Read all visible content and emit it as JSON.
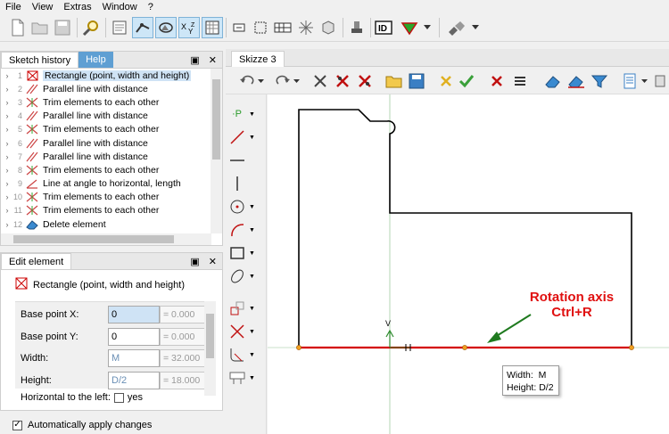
{
  "menu": [
    "File",
    "View",
    "Extras",
    "Window",
    "?"
  ],
  "colors": {
    "accent_blue": "#5f9fd3",
    "selection": "#cfe3f5",
    "sketch_line": "#000000",
    "axis_red": "#d40000",
    "axis_green": "#2e8b2e",
    "annotation_red": "#e01010",
    "annotation_arrow": "#1f7a1f",
    "canvas_bg": "#ffffff"
  },
  "toolbar": {
    "icons": [
      "new-icon",
      "open-icon",
      "save-icon",
      "search-icon",
      "sketch-icon",
      "select-icon",
      "rotate-icon",
      "xy-icon",
      "grid-icon",
      "dim-icon",
      "box-icon",
      "table-icon",
      "sparkle-icon",
      "cube-icon",
      "stamp-icon",
      "id-icon",
      "dropdown-icon",
      "plug-icon"
    ]
  },
  "sketch_history": {
    "tab_active": "Sketch history",
    "tab_inactive": "Help",
    "items": [
      {
        "num": "1",
        "label": "Rectangle (point, width and height)",
        "icon": "rectangle-icon",
        "selected": true
      },
      {
        "num": "2",
        "label": "Parallel line with distance",
        "icon": "parallel-icon"
      },
      {
        "num": "3",
        "label": "Trim elements to each other",
        "icon": "trim-icon"
      },
      {
        "num": "4",
        "label": "Parallel line with distance",
        "icon": "parallel-icon"
      },
      {
        "num": "5",
        "label": "Trim elements to each other",
        "icon": "trim-icon"
      },
      {
        "num": "6",
        "label": "Parallel line with distance",
        "icon": "parallel-icon"
      },
      {
        "num": "7",
        "label": "Parallel line with distance",
        "icon": "parallel-icon"
      },
      {
        "num": "8",
        "label": "Trim elements to each other",
        "icon": "trim-icon"
      },
      {
        "num": "9",
        "label": "Line at angle to horizontal, length",
        "icon": "angle-line-icon"
      },
      {
        "num": "10",
        "label": "Trim elements to each other",
        "icon": "trim-icon"
      },
      {
        "num": "11",
        "label": "Trim elements to each other",
        "icon": "trim-icon"
      },
      {
        "num": "12",
        "label": "Delete element",
        "icon": "eraser-icon"
      }
    ]
  },
  "edit_element": {
    "tab": "Edit element",
    "title": "Rectangle (point, width and height)",
    "fields": [
      {
        "label": "Base point X:",
        "value": "0",
        "computed": "= 0.000"
      },
      {
        "label": "Base point Y:",
        "value": "0",
        "computed": "= 0.000"
      },
      {
        "label": "Width:",
        "value": "M",
        "computed": "= 32.000"
      },
      {
        "label": "Height:",
        "value": "D/2",
        "computed": "= 18.000"
      }
    ],
    "partial_row": "Horizontal to the left:",
    "partial_value": "yes",
    "auto_apply": "Automatically apply changes"
  },
  "sketch": {
    "tab": "Skizze 3",
    "annotation_line1": "Rotation axis",
    "annotation_line2": "Ctrl+R",
    "tooltip_width_label": "Width:",
    "tooltip_width_value": "M",
    "tooltip_height_label": "Height:",
    "tooltip_height_value": "D/2",
    "axis_marker": "V"
  }
}
